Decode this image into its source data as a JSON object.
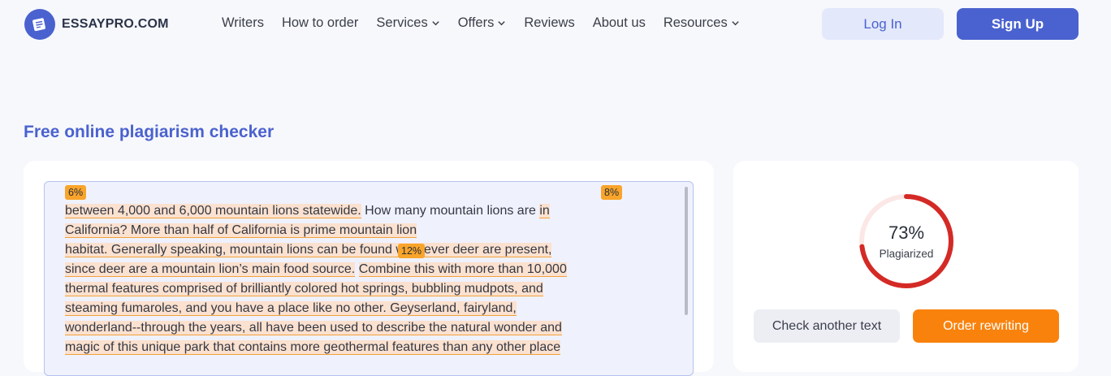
{
  "header": {
    "logo_text": "ESSAYPRO.COM",
    "logo_icon": "essay-document-icon",
    "nav": [
      {
        "label": "Writers",
        "dropdown": false
      },
      {
        "label": "How to order",
        "dropdown": false
      },
      {
        "label": "Services",
        "dropdown": true
      },
      {
        "label": "Offers",
        "dropdown": true
      },
      {
        "label": "Reviews",
        "dropdown": false
      },
      {
        "label": "About us",
        "dropdown": false
      },
      {
        "label": "Resources",
        "dropdown": true
      }
    ],
    "login_label": "Log In",
    "signup_label": "Sign Up"
  },
  "page_title": "Free online plagiarism checker",
  "checker": {
    "badges": [
      "6%",
      "8%",
      "12%"
    ],
    "lines": [
      {
        "segments": [
          {
            "text": "between 4,000 and 6,000 mountain lions statewide.",
            "hl": true
          },
          {
            "text": " How many mountain lions are ",
            "hl": false
          },
          {
            "text": "in",
            "hl": true
          }
        ]
      },
      {
        "segments": [
          {
            "text": "California? More than half of California is prime mountain lion",
            "hl": true
          }
        ]
      },
      {
        "segments": [
          {
            "text": "habitat. Generally speaking, mountain lions can be fo",
            "hl": true
          },
          {
            "text": "und wherever deer are present, ",
            "hl": true
          }
        ]
      },
      {
        "segments": [
          {
            "text": "since deer are a mountain lion’s main food source.",
            "hl": true
          },
          {
            "text": " ",
            "hl": false
          },
          {
            "text": "Combine this with more than 10,000",
            "hl": true
          }
        ]
      },
      {
        "segments": [
          {
            "text": "thermal features comprised of brilliantly colored hot springs, bubbling mudpots, and",
            "hl": true
          }
        ]
      },
      {
        "segments": [
          {
            "text": "steaming fumaroles, and you have a place like no other. Geyserland, fairyland, ",
            "hl": true
          }
        ]
      },
      {
        "segments": [
          {
            "text": "wonderland--through the years, all have been used to describe the natural wonder and",
            "hl": true
          }
        ]
      },
      {
        "segments": [
          {
            "text": "magic of this unique park that contains more geothermal features than any other place",
            "hl": true
          }
        ]
      }
    ]
  },
  "result": {
    "percent": 73,
    "percent_label": "73%",
    "status_label": "Plagiarized",
    "check_another_label": "Check another text",
    "order_rewriting_label": "Order rewriting"
  },
  "colors": {
    "accent": "#4a62cf",
    "highlight_bg": "#fbe1cf",
    "highlight_line": "#f3a13a",
    "badge": "#f9a42a",
    "gauge": "#d42a26",
    "order_button": "#f9820d"
  }
}
